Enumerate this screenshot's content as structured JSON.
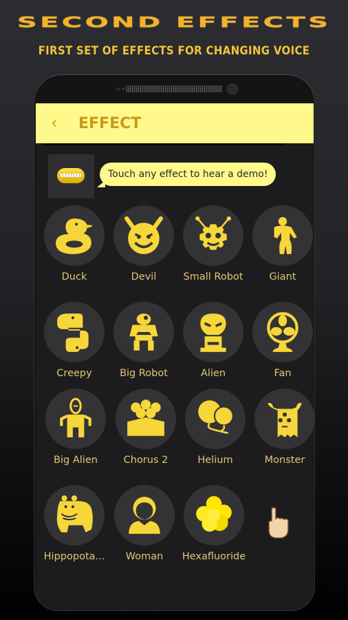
{
  "promo": {
    "title": "SECOND EFFECTS",
    "subtitle": "FIRST SET OF EFFECTS FOR CHANGING VOICE"
  },
  "appbar": {
    "back_icon": "chevron-left-icon",
    "title": "EFFECT"
  },
  "hint": {
    "avatar_icon": "mouth-icon",
    "message": "Touch any effect to hear a demo!"
  },
  "effects": [
    {
      "label": "Duck",
      "icon": "duck-icon"
    },
    {
      "label": "Devil",
      "icon": "devil-icon"
    },
    {
      "label": "Small Robot",
      "icon": "small-robot-icon"
    },
    {
      "label": "Giant",
      "icon": "giant-icon"
    },
    {
      "label": "Creepy",
      "icon": "snake-icon"
    },
    {
      "label": "Big Robot",
      "icon": "big-robot-icon"
    },
    {
      "label": "Alien",
      "icon": "alien-icon"
    },
    {
      "label": "Fan",
      "icon": "fan-icon"
    },
    {
      "label": "Big Alien",
      "icon": "big-alien-icon"
    },
    {
      "label": "Chorus 2",
      "icon": "chorus-icon"
    },
    {
      "label": "Helium",
      "icon": "balloons-icon"
    },
    {
      "label": "Monster",
      "icon": "monster-icon"
    },
    {
      "label": "Hippopota...",
      "icon": "hippo-icon"
    },
    {
      "label": "Woman",
      "icon": "woman-icon"
    },
    {
      "label": "Hexafluoride",
      "icon": "molecule-icon"
    }
  ],
  "cursor": {
    "icon": "pointing-hand-icon"
  },
  "colors": {
    "accent_yellow": "#fff88a",
    "icon_yellow": "#f7d63a",
    "title_orange": "#f6b126",
    "label_gold": "#e4c774",
    "circle_bg": "#333335"
  }
}
